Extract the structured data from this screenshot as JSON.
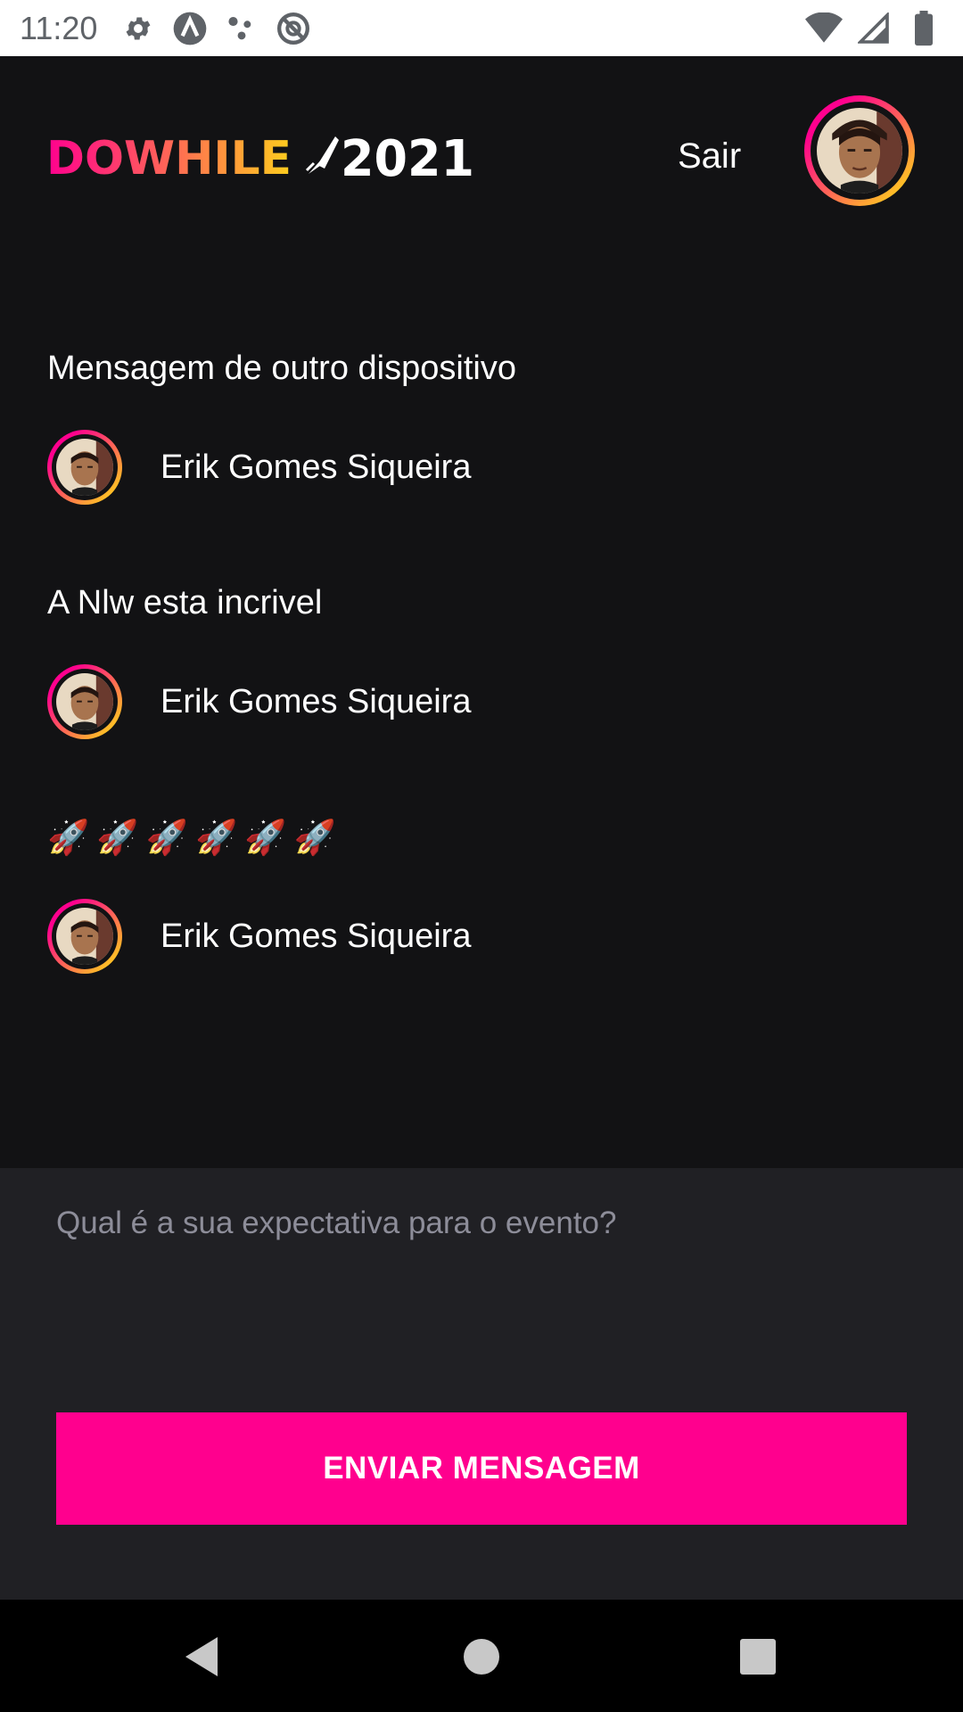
{
  "status_bar": {
    "time": "11:20",
    "left_icons": [
      "settings-icon",
      "a-circle-icon",
      "dots-icon",
      "no-sync-icon"
    ],
    "right_icons": [
      "wifi-icon",
      "signal-icon",
      "battery-icon"
    ]
  },
  "header": {
    "logo_text": "DOWHILE 2021",
    "logout_label": "Sair"
  },
  "messages": [
    {
      "text": "Mensagem de outro dispositivo",
      "user": "Erik Gomes Siqueira"
    },
    {
      "text": "A Nlw esta incrivel",
      "user": "Erik Gomes Siqueira"
    },
    {
      "text": "🚀🚀🚀🚀🚀🚀",
      "user": "Erik Gomes Siqueira"
    }
  ],
  "send_form": {
    "placeholder": "Qual é a sua expectativa para o evento?",
    "button_label": "ENVIAR MENSAGEM"
  },
  "colors": {
    "background": "#121214",
    "form_background": "#202024",
    "accent": "#ff008e",
    "gradient_end": "#ffcd1e",
    "placeholder": "#8d8d99"
  }
}
